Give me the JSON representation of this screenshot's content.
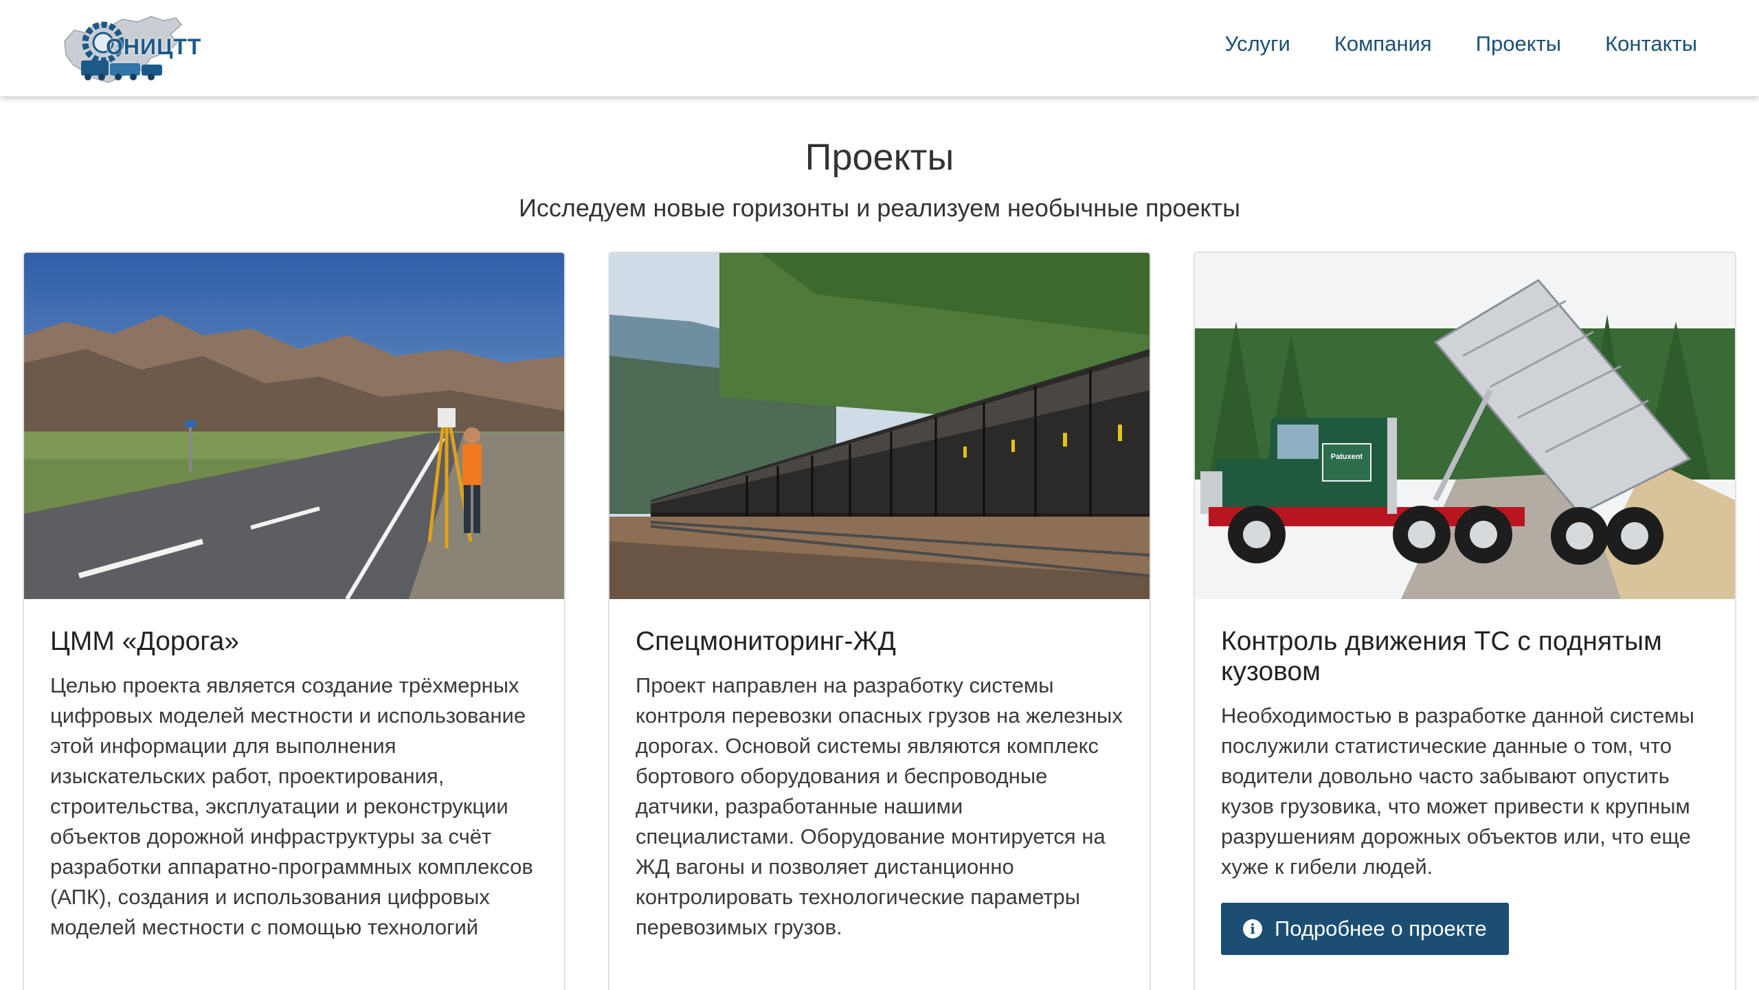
{
  "header": {
    "logo_text": "ОНИЦТТ",
    "nav": [
      "Услуги",
      "Компания",
      "Проекты",
      "Контакты"
    ]
  },
  "section": {
    "title": "Проекты",
    "subtitle": "Исследуем новые горизонты и реализуем необычные проекты"
  },
  "cards": [
    {
      "title": "ЦММ «Дорога»",
      "text": "Целью проекта является создание трёхмерных цифровых моделей местности и использование этой информации для выполнения изыскательских работ, проектирования, строительства, эксплуатации и реконструкции объектов дорожной инфраструктуры за счёт разработки аппаратно-программных комплексов (АПК), создания и использования цифровых моделей местности с помощью технологий"
    },
    {
      "title": "Спецмониторинг-ЖД",
      "text": "Проект направлен на разработку системы контроля перевозки опасных грузов на железных дорогах. Основой системы являются комплекс бортового оборудования и беспроводные датчики, разработанные нашими специалистами. Оборудование монтируется на ЖД вагоны и позволяет дистанционно контролировать технологические параметры перевозимых грузов."
    },
    {
      "title": "Контроль движения ТС с поднятым кузовом",
      "text": "Необходимостью в разработке данной системы послужили статистические данные о том, что водители довольно часто забывают опустить кузов грузовика, что может привести к крупным разрушениям дорожных объектов или, что еще хуже к гибели людей.",
      "button": "Подробнее о проекте",
      "truck_sign": "Patuxent"
    }
  ],
  "colors": {
    "nav_text": "#1c4f74",
    "button_bg": "#1b4e72",
    "logo_blue": "#1b5a88"
  }
}
